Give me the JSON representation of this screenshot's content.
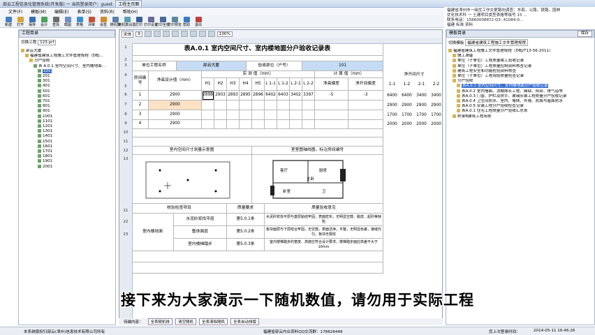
{
  "window": {
    "title": "部云工程信息化管理系统(开发版) 一 当前登录用户：guest",
    "title_tab": "工程主页面"
  },
  "menu": [
    "文件(F)",
    "模板(M)",
    "编辑(E)",
    "表单(S)",
    "资料(R)",
    "帮助(H)"
  ],
  "toolbar": [
    {
      "label": "新建",
      "color": "#4a7fc2"
    },
    {
      "label": "打开",
      "color": "#d4a73a"
    },
    {
      "label": "保存",
      "color": "#3a6fb0"
    },
    {
      "label": "设计",
      "color": "#4aa05a"
    },
    {
      "label": "查找",
      "color": "#6b6b6b"
    },
    {
      "label": "截图",
      "color": "#6a8fc8"
    },
    {
      "label": "表格",
      "color": "#3f8fd0"
    },
    {
      "label": "评审",
      "color": "#c8503a"
    },
    {
      "label": "会签",
      "color": "#d48a30"
    },
    {
      "label": "随机数",
      "color": "#5a7fb0"
    },
    {
      "label": "随机数设置",
      "color": "#5a9fb0"
    },
    {
      "label": "打印",
      "color": "#3a5f9a"
    },
    {
      "label": "打印设置",
      "color": "#6a6a9a"
    },
    {
      "label": "打印全部",
      "color": "#4a6a9a"
    },
    {
      "label": "打印预览",
      "color": "#5a8a9a"
    },
    {
      "label": "帮助",
      "color": "#3a7ac0"
    },
    {
      "label": "退出",
      "color": "#c04040"
    }
  ],
  "announcement": {
    "lines": [
      "福建省漳州市一级优工作交更路向调查：东部，公路，铁路，园林",
      "优化技术科 一 土建项目类型表格等级号 15 ...",
      "联系电话：15860008872  Q3: 41084-0... ",
      "福建 标准 资料"
    ]
  },
  "left_panel": {
    "header": "工程目录",
    "switch_label": "切换工程",
    "switch_value": "123.prf",
    "tree": [
      {
        "indent": 0,
        "text": "部云大厦"
      },
      {
        "indent": 1,
        "text": "福建省建筑工程施工文件管理规程（DBJ..."
      },
      {
        "indent": 2,
        "text": "分户验收"
      },
      {
        "indent": 3,
        "text": "表 A.0.1 室内空间尺寸、室内楼地面..."
      },
      {
        "indent": 4,
        "text": "101",
        "selected": true
      },
      {
        "indent": 4,
        "text": "201"
      },
      {
        "indent": 4,
        "text": "301"
      },
      {
        "indent": 4,
        "text": "401"
      },
      {
        "indent": 4,
        "text": "501"
      },
      {
        "indent": 4,
        "text": "601"
      },
      {
        "indent": 4,
        "text": "701"
      },
      {
        "indent": 4,
        "text": "801"
      },
      {
        "indent": 4,
        "text": "901"
      },
      {
        "indent": 4,
        "text": "1001"
      },
      {
        "indent": 4,
        "text": "1101"
      },
      {
        "indent": 4,
        "text": "1201"
      },
      {
        "indent": 4,
        "text": "1301"
      },
      {
        "indent": 4,
        "text": "1401"
      },
      {
        "indent": 4,
        "text": "1501"
      },
      {
        "indent": 4,
        "text": "1601"
      },
      {
        "indent": 4,
        "text": "1701"
      },
      {
        "indent": 4,
        "text": "1801"
      },
      {
        "indent": 4,
        "text": "1901"
      },
      {
        "indent": 4,
        "text": "2001"
      }
    ]
  },
  "formatbar": {
    "font": "宋体",
    "size": "9",
    "zoom": "100%"
  },
  "sheet": {
    "title": "表A.0.1  室内空间尺寸、室内楼地面分户验收记录表",
    "unit_label": "单位工程名称",
    "unit_value": "部云大厦",
    "part_label": "验收部位（户号）",
    "part_value": "101",
    "room_no_label": "房间编号",
    "net_height_label": "净高设计值（mm）",
    "measured_label": "实  测  值（mm）",
    "calc_label": "计  算  值（mm）",
    "h_cols": [
      "H1",
      "H2",
      "H3",
      "H4",
      "H5"
    ],
    "l_cols": [
      "L 1-1",
      "L 1-2",
      "L 2-1",
      "L 2-2"
    ],
    "net_height_diff": "净高偏差",
    "room_deviation": "净开间偏差",
    "right_head": "净开间尺寸",
    "right_sub": [
      "1-1",
      "1-2",
      "2-1",
      "2-2"
    ],
    "rows": [
      {
        "rn": "7",
        "room": "1",
        "design": "2900",
        "h": [
          "2898",
          "2903",
          "2893",
          "2895",
          "2896"
        ],
        "l": [
          "6402",
          "6403",
          "3402",
          "3397"
        ],
        "hd": "-5",
        "rd": "-3",
        "right": [
          "6400",
          "6400",
          "3400",
          "3400"
        ]
      },
      {
        "rn": "8",
        "room": "2",
        "design": "2900",
        "h": [],
        "l": [],
        "hd": "",
        "rd": "",
        "right": [
          "2900",
          "2900",
          "2900",
          "2900"
        ]
      },
      {
        "rn": "9",
        "room": "3",
        "design": "2900",
        "h": [],
        "l": [],
        "hd": "",
        "rd": "",
        "right": [
          "1700",
          "1700",
          "1700",
          "1700"
        ]
      },
      {
        "rn": "10",
        "room": "4",
        "design": "2900",
        "h": [],
        "l": [],
        "hd": "",
        "rd": "",
        "right": [
          "2000",
          "2000",
          "2000",
          "2000"
        ]
      }
    ],
    "diagram_left_title": "室内空间尺寸测量示意图",
    "diagram_right_title": "室室图轴线图，标注房间编号",
    "plan_labels": [
      "客厅",
      "厨房",
      "卧室",
      "卫",
      "主卧"
    ],
    "check_item": "核验检查项目",
    "quality_req": "质量要求",
    "check_opinion": "质量验收意见",
    "row21_item": "水泥砂浆找平层",
    "row21_req": "第5.0.1条",
    "row21_text": "水泥砂浆找平层与基层粘结牢固，表面密实，无明显空鼓、脱皮、起砂等缺陷",
    "row22_item": "整体面层",
    "row22_req": "第5.0.2条",
    "row22_text": "板块面层与下层结合牢固，无空鼓，表面洁净，平整，无明显色差，接缝均匀，板块无裂纹",
    "row23_item": "室内楼梯踏步",
    "row23_req": "第5.0.3条",
    "row23_text": "室内楼梯踏步的宽度、高度应符合设计要求，楼梯踏步面应高差不大于10mm",
    "group_label": "室内楼地面",
    "rn_list": [
      "1",
      "2",
      "3",
      "4",
      "5",
      "6",
      "7",
      "8",
      "9",
      "10",
      "11",
      "12",
      "13",
      "14",
      "15",
      "16",
      "17",
      "18",
      "19",
      "20",
      "21",
      "22",
      "23"
    ]
  },
  "bottom_tabs": [
    "全表随机排",
    "清空随机",
    "全表清除随机",
    "全表自动排版"
  ],
  "sheet_tab_label": "待编内容：",
  "right_panel": {
    "header": "模板目录",
    "save_label": "保存",
    "switch_label": "切换模板",
    "switch_value": "福建省建筑工程施工文件管理规程",
    "tree": [
      {
        "indent": 0,
        "text": "福建省建筑工程施工文件管理规程（DBJ/T13-56-2011）"
      },
      {
        "indent": 1,
        "text": "施工准备"
      },
      {
        "indent": 1,
        "text": "单位（子单位）工程质量竣工验收记录"
      },
      {
        "indent": 1,
        "text": "单位（子单位）工程质量控制资料核查记录"
      },
      {
        "indent": 1,
        "text": "建筑工程安全和功能检验资料核查"
      },
      {
        "indent": 1,
        "text": "单位（子单位）工程观感质量检查记录"
      },
      {
        "indent": 1,
        "text": "分户验收"
      },
      {
        "indent": 2,
        "text": "表A.0.1 室内空间尺寸、室内楼地面分户验收记录",
        "selected": true
      },
      {
        "indent": 2,
        "text": "表A.0.2 室内墙面、顶棚抹灰工程、细部、阳台、排气道等"
      },
      {
        "indent": 2,
        "text": "表A.0.3 门窗、护栏及扶手、玻璃安装工程质量分户验收记录"
      },
      {
        "indent": 2,
        "text": "表A.0.4 卫生间防水、室内、墙体、外墙、防腐与屋面防水"
      },
      {
        "indent": 2,
        "text": "表A.0.5 安装工程分户验收检查记录"
      },
      {
        "indent": 2,
        "text": "表A.0.1 住宅工程质量分户验收汇总表"
      },
      {
        "indent": 1,
        "text": "附录B建筑工程用表"
      }
    ]
  },
  "subtitle": "接下来为大家演示一下随机数值，请勿用于实际工程",
  "status": {
    "left": "本系统版权归部云(漳州)信息技术有限公司所有",
    "center": "福建省部云内业资料QQ交流群：178826448",
    "right_label": "您上次登录时间：",
    "right_time": "2014-05-11  16:46:26"
  }
}
